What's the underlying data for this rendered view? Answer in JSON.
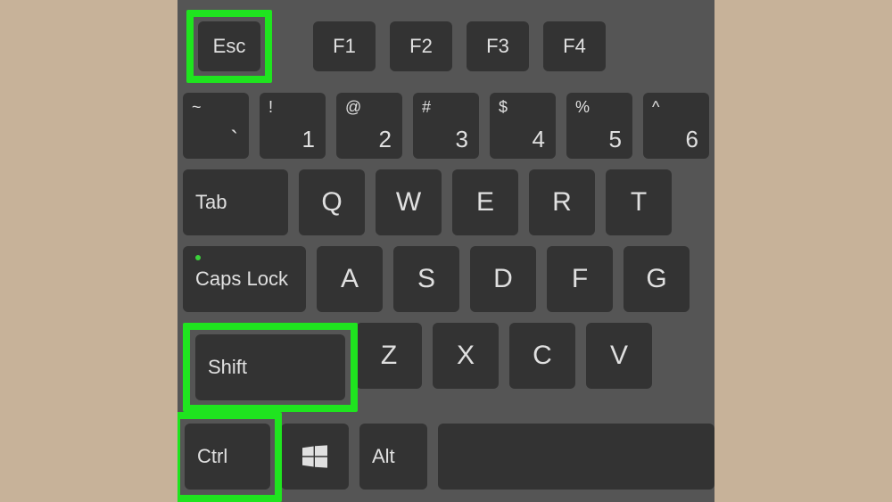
{
  "colors": {
    "highlight": "#1fe41f",
    "key_bg": "#333333",
    "board_bg": "#555555",
    "page_bg": "#c7b299"
  },
  "row_fn": {
    "esc": "Esc",
    "f1": "F1",
    "f2": "F2",
    "f3": "F3",
    "f4": "F4"
  },
  "row_num": {
    "backtick": {
      "upper": "~",
      "lower": "`"
    },
    "n1": {
      "upper": "!",
      "lower": "1"
    },
    "n2": {
      "upper": "@",
      "lower": "2"
    },
    "n3": {
      "upper": "#",
      "lower": "3"
    },
    "n4": {
      "upper": "$",
      "lower": "4"
    },
    "n5": {
      "upper": "%",
      "lower": "5"
    },
    "n6": {
      "upper": "^",
      "lower": "6"
    }
  },
  "row_q": {
    "tab": "Tab",
    "q": "Q",
    "w": "W",
    "e": "E",
    "r": "R",
    "t": "T"
  },
  "row_a": {
    "caps": "Caps Lock",
    "a": "A",
    "s": "S",
    "d": "D",
    "f": "F",
    "g": "G"
  },
  "row_z": {
    "shift": "Shift",
    "z": "Z",
    "x": "X",
    "c": "C",
    "v": "V"
  },
  "row_ctrl": {
    "ctrl": "Ctrl",
    "win": "windows-icon",
    "alt": "Alt"
  }
}
